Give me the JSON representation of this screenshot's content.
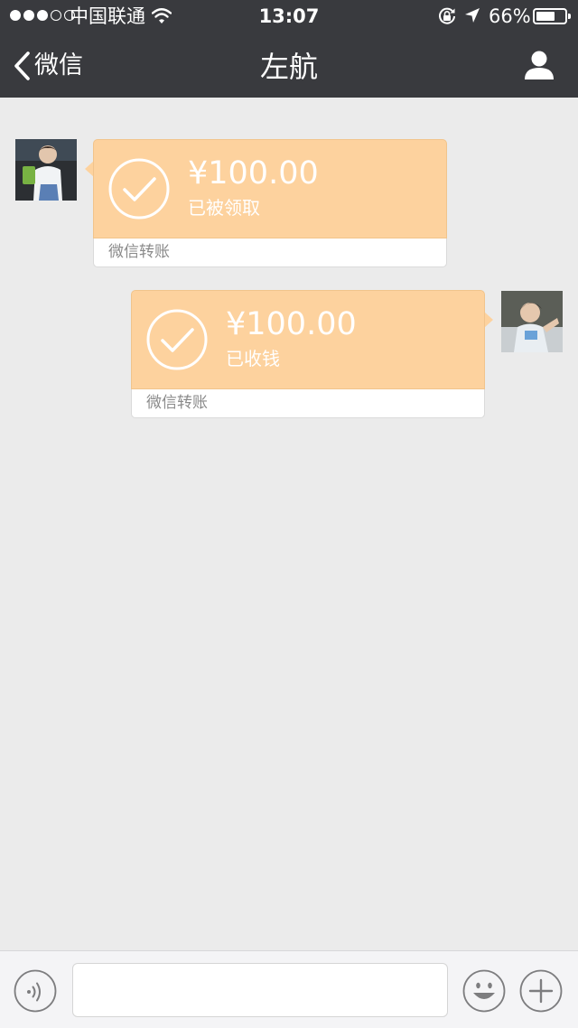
{
  "status_bar": {
    "carrier": "中国联通",
    "time": "13:07",
    "battery_percent_label": "66%",
    "battery_level": 0.66,
    "signal_bars_filled": 3,
    "signal_bars_total": 5
  },
  "nav": {
    "back_label": "微信",
    "title": "左航",
    "back_icon": "chevron-left-icon",
    "profile_icon": "person-icon"
  },
  "messages": [
    {
      "side": "left",
      "amount": "¥100.00",
      "status": "已被领取",
      "transfer_label": "微信转账"
    },
    {
      "side": "right",
      "amount": "¥100.00",
      "status": "已收钱",
      "transfer_label": "微信转账"
    }
  ],
  "input_bar": {
    "voice_icon": "voice-icon",
    "emoji_icon": "emoji-icon",
    "plus_icon": "plus-icon",
    "message_value": ""
  },
  "colors": {
    "nav_background": "#393a3e",
    "chat_background": "#ebebeb",
    "transfer_bubble": "#fdd29e",
    "input_bar_background": "#f4f4f6"
  }
}
